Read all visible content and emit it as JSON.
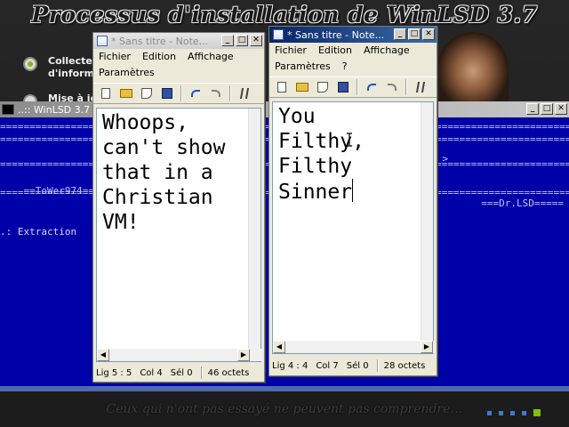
{
  "installer": {
    "title": "Processus d'installation de WinLSD 3.7",
    "steps": [
      {
        "label": "Collecte d'information",
        "state": "done"
      },
      {
        "label": "Mise à jo",
        "state": "pending"
      }
    ],
    "footer_quote": "Ceux qui n'ont pas essayé ne peuvent pas comprendre…"
  },
  "console": {
    "title": "..:: WinLSD 3.7 ::..",
    "rule_line": "=============================================================================================================",
    "left_tag": "==ToWer974==",
    "right_tag": "===Dr.LSD=====",
    "right_arrow": ">",
    "status_line": ".: Extraction"
  },
  "notepad_left": {
    "title": "* Sans titre - Note...",
    "menu": [
      "Fichier",
      "Edition",
      "Affichage",
      "Paramètres"
    ],
    "text_lines": [
      "Whoops,",
      "can't show",
      "that in a",
      "Christian",
      "VM!"
    ],
    "status": {
      "line": "Lig 5 : 5",
      "col": "Col 4",
      "sel": "Sél 0",
      "size": "46 octets"
    }
  },
  "notepad_right": {
    "title": "* Sans titre - Note...",
    "menu": [
      "Fichier",
      "Edition",
      "Affichage",
      "Paramètres",
      "?"
    ],
    "text_lines": [
      "You",
      "Filthy,",
      "Filthy",
      "Sinner"
    ],
    "status": {
      "line": "Lig 4 : 4",
      "col": "Col 7",
      "sel": "Sél 0",
      "size": "28 octets"
    }
  },
  "window_buttons": {
    "minimize": "_",
    "maximize": "□",
    "close": "✕"
  },
  "scroll_arrows": {
    "up": "▲",
    "down": "▼",
    "left": "◀",
    "right": "▶"
  },
  "colors": {
    "console_bg": "#0000a8",
    "active_title": "#0a246a",
    "accent_green": "#7fbf00"
  }
}
